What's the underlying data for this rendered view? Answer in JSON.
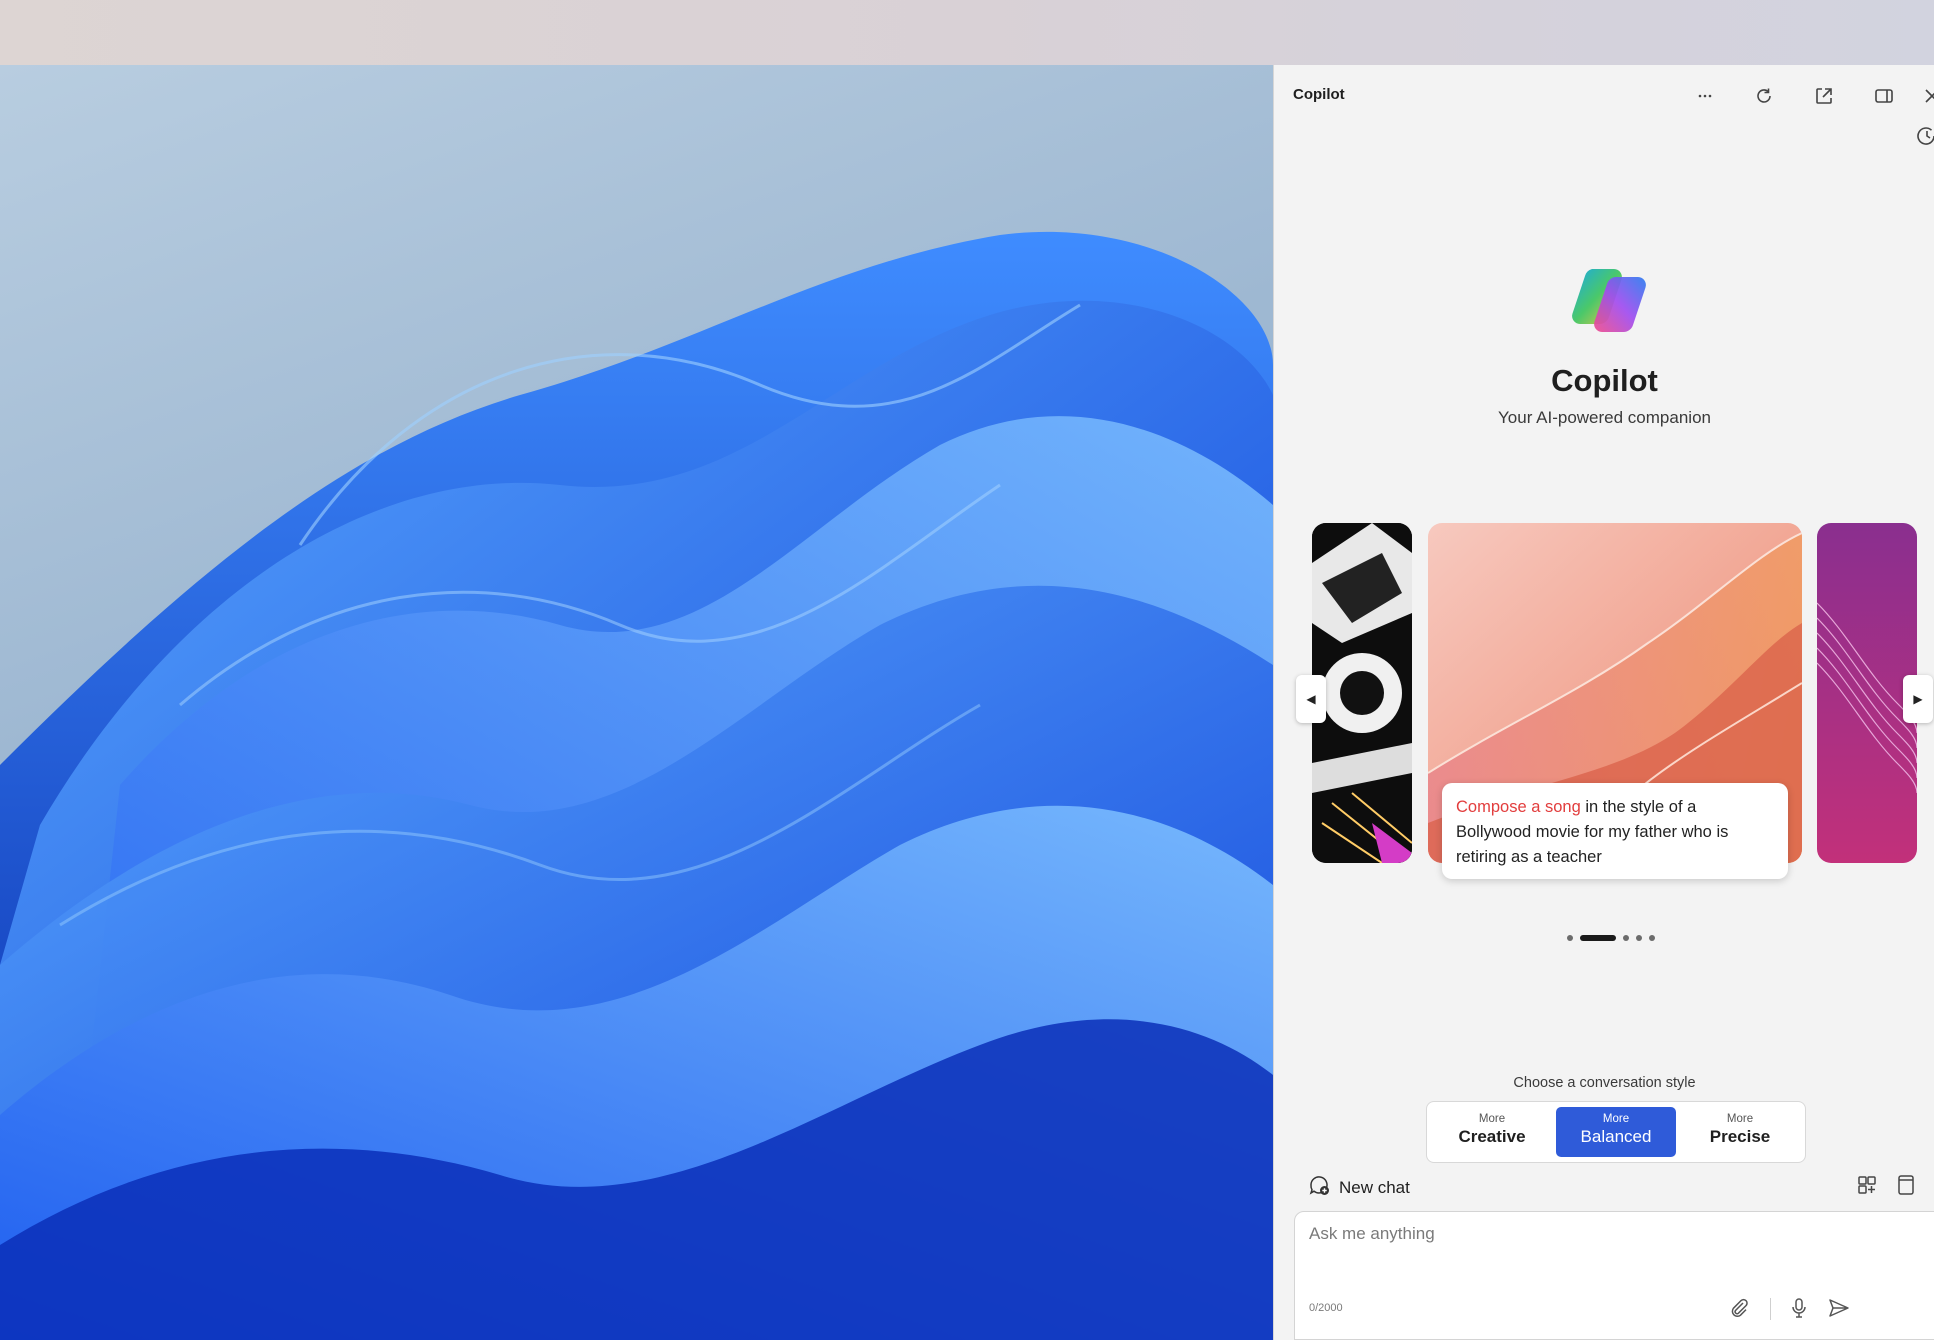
{
  "window": {
    "title": "Copilot"
  },
  "titlebar": {
    "more_icon": "more-horizontal-icon",
    "refresh_icon": "refresh-icon",
    "open_external_icon": "open-external-icon",
    "dock_icon": "dock-side-icon",
    "close_icon": "close-icon",
    "history_icon": "history-icon"
  },
  "hero": {
    "title": "Copilot",
    "subtitle": "Your AI-powered companion"
  },
  "carousel": {
    "prompt_highlight": "Compose a song",
    "prompt_rest": " in the style of a Bollywood movie for my father who is retiring as a teacher",
    "prev_label": "◀",
    "next_label": "▶",
    "dot_count": 5,
    "active_dot": 2
  },
  "conversation_style": {
    "label": "Choose a conversation style",
    "options": [
      {
        "small": "More",
        "big": "Creative"
      },
      {
        "small": "More",
        "big": "Balanced"
      },
      {
        "small": "More",
        "big": "Precise"
      }
    ],
    "selected": "Balanced"
  },
  "composer": {
    "new_chat_label": "New chat",
    "placeholder": "Ask me anything",
    "counter": "0/2000"
  },
  "colors": {
    "accent": "#2f5bd9",
    "prompt_highlight": "#e23d3d",
    "panel_bg": "#f3f3f3"
  }
}
